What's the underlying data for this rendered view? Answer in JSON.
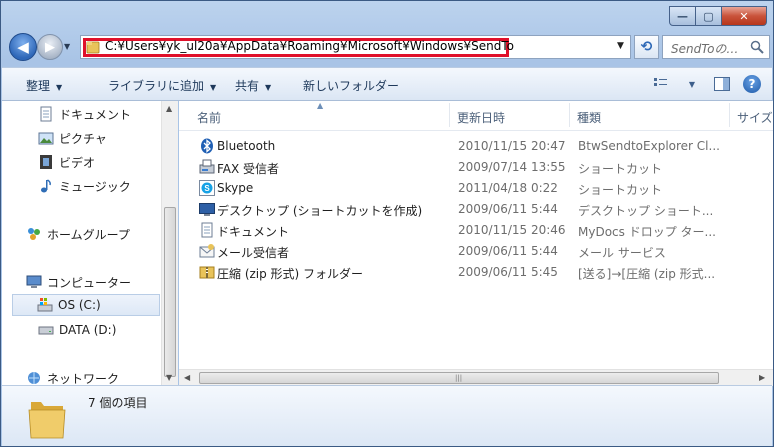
{
  "window": {
    "caption_buttons": {
      "minimize": "—",
      "maximize": "▢",
      "close": "✕"
    }
  },
  "address": {
    "path": "C:¥Users¥yk_ul20a¥AppData¥Roaming¥Microsoft¥Windows¥SendTo",
    "search_placeholder": "SendToの…",
    "highlight_color": "#e0102a"
  },
  "toolbar": {
    "organize": "整理",
    "add_to_library": "ライブラリに追加",
    "share": "共有",
    "new_folder": "新しいフォルダー"
  },
  "sidebar": {
    "items": [
      {
        "label": "ドキュメント",
        "icon": "documents-icon"
      },
      {
        "label": "ピクチャ",
        "icon": "pictures-icon"
      },
      {
        "label": "ビデオ",
        "icon": "video-icon"
      },
      {
        "label": "ミュージック",
        "icon": "music-icon"
      },
      {
        "label": "ホームグループ",
        "icon": "homegroup-icon"
      },
      {
        "label": "コンピューター",
        "icon": "computer-icon"
      },
      {
        "label": "OS (C:)",
        "icon": "drive-c-icon",
        "selected": true
      },
      {
        "label": "DATA (D:)",
        "icon": "drive-d-icon"
      },
      {
        "label": "ネットワーク",
        "icon": "network-icon"
      }
    ]
  },
  "list": {
    "columns": [
      "名前",
      "更新日時",
      "種類",
      "サイズ"
    ],
    "rows": [
      {
        "name": "Bluetooth",
        "date": "2010/11/15 20:47",
        "type": "BtwSendtoExplorer Cl...",
        "icon": "bluetooth-icon"
      },
      {
        "name": "FAX 受信者",
        "date": "2009/07/14 13:55",
        "type": "ショートカット",
        "icon": "fax-icon"
      },
      {
        "name": "Skype",
        "date": "2011/04/18 0:22",
        "type": "ショートカット",
        "icon": "skype-icon"
      },
      {
        "name": "デスクトップ (ショートカットを作成)",
        "date": "2009/06/11 5:44",
        "type": "デスクトップ ショート...",
        "icon": "desktop-icon"
      },
      {
        "name": "ドキュメント",
        "date": "2010/11/15 20:46",
        "type": "MyDocs ドロップ ター...",
        "icon": "documents-icon"
      },
      {
        "name": "メール受信者",
        "date": "2009/06/11 5:44",
        "type": "メール サービス",
        "icon": "mail-icon"
      },
      {
        "name": "圧縮 (zip 形式) フォルダー",
        "date": "2009/06/11 5:45",
        "type": "[送る]→[圧縮 (zip 形式...",
        "icon": "zip-folder-icon"
      }
    ]
  },
  "details": {
    "item_count": "7 個の項目"
  }
}
